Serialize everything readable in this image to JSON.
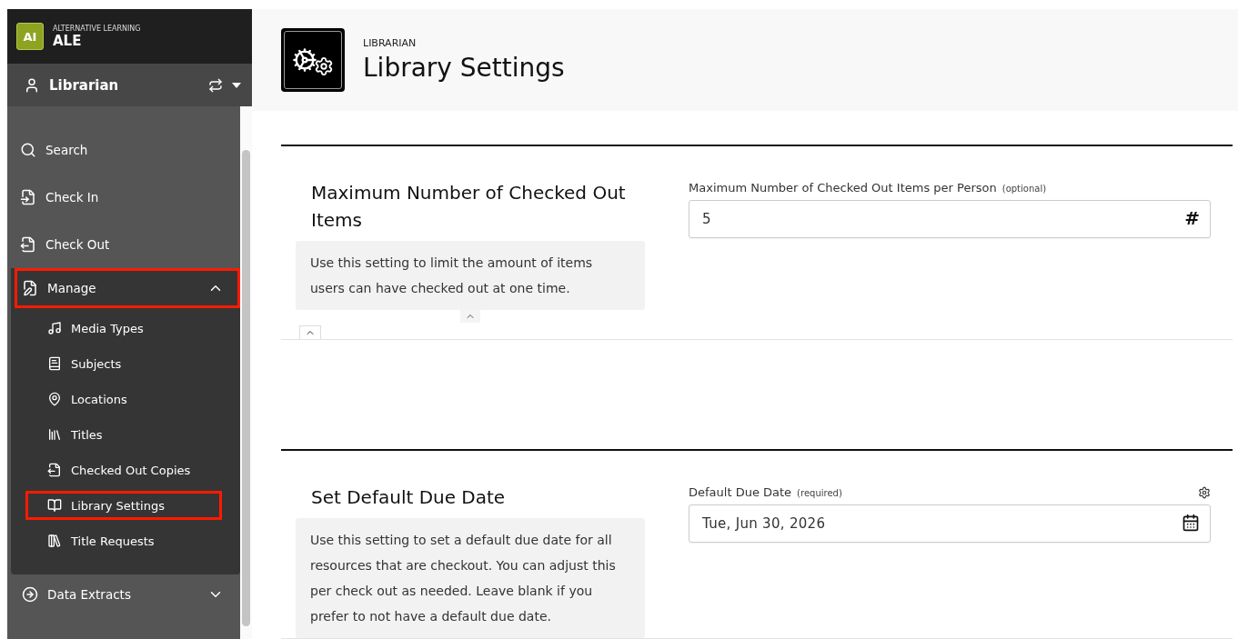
{
  "brand": {
    "logo_text": "AI",
    "tagline": "ALTERNATIVE LEARNING",
    "name": "ALE"
  },
  "role": {
    "label": "Librarian"
  },
  "nav": [
    {
      "kind": "link",
      "label": "Search",
      "highlighted": false
    },
    {
      "kind": "link",
      "label": "Check In",
      "highlighted": false
    },
    {
      "kind": "link",
      "label": "Check Out",
      "highlighted": false
    },
    {
      "kind": "group",
      "label": "Manage",
      "highlighted": true,
      "expanded": true,
      "children": [
        {
          "label": "Media Types",
          "highlighted": false
        },
        {
          "label": "Subjects",
          "highlighted": false
        },
        {
          "label": "Locations",
          "highlighted": false
        },
        {
          "label": "Titles",
          "highlighted": false
        },
        {
          "label": "Checked Out Copies",
          "highlighted": false
        },
        {
          "label": "Library Settings",
          "highlighted": true
        },
        {
          "label": "Title Requests",
          "highlighted": false
        }
      ]
    },
    {
      "kind": "group",
      "label": "Data Extracts",
      "highlighted": false,
      "expanded": false
    }
  ],
  "header": {
    "overline": "LIBRARIAN",
    "title": "Library Settings"
  },
  "settings": [
    {
      "title": "Maximum Number of Checked Out Items",
      "description": "Use this setting to limit the amount of items users can have checked out at one time.",
      "field": {
        "kind": "number",
        "label": "Maximum Number of Checked Out Items per Person",
        "hint": "(optional)",
        "value": "5",
        "adornment": "#"
      }
    },
    {
      "title": "Set Default Due Date",
      "description": "Use this setting to set a default due date for all resources that are checkout. You can adjust this per check out as needed. Leave blank if you prefer to not have a default due date.",
      "field": {
        "kind": "date",
        "label": "Default Due Date",
        "hint": "(required)",
        "value": "Tue, Jun 30, 2026"
      }
    }
  ]
}
